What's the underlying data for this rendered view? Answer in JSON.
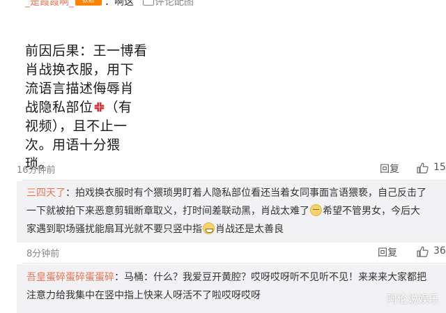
{
  "top": {
    "username": "_是霞霞啊_",
    "badge": "铁粉",
    "text": "：啊这",
    "image_label": "评论配图"
  },
  "comment_image": {
    "line1": "前因后果：王一博看",
    "line2": "肖战换衣服，用下",
    "line3": "流语言描述侮辱肖",
    "line4a": "战隐私部位",
    "line4b": "（有",
    "line5": "视频），且不止一",
    "line6": "次。用语十分猥",
    "line7": "琐。"
  },
  "first": {
    "time": "16分钟前",
    "reply_label": "回复",
    "likes": "15"
  },
  "reply1": {
    "user": "三四天了",
    "line1": "：拍戏换衣服时有个猥琐男盯着人隐私部位看还当着女同事面言语猥亵，自己反击了",
    "line2a": "一下就被拍下来恶意剪辑断章取义，打时间差联动黑，肖战太难了",
    "line2b": "希望不管男女，今后大",
    "line3a": "家遇到职场骚扰能扇耳光就不要只竖中指",
    "line3b": "肖战还是太善良",
    "time": "8分钟前",
    "reply_label": "回复",
    "likes": "36"
  },
  "reply2": {
    "user": "吾皇蛋碎蛋碎蛋蛋碎",
    "line1": "：马桶：什么？我爱豆开黄腔？哎呀哎呀听不见听不见！来来来大家都把",
    "line2": "注意力给我集中在竖中指上快来人呀活不了啦哎呀哎呀"
  },
  "watermark": "阿伦说娱乐"
}
